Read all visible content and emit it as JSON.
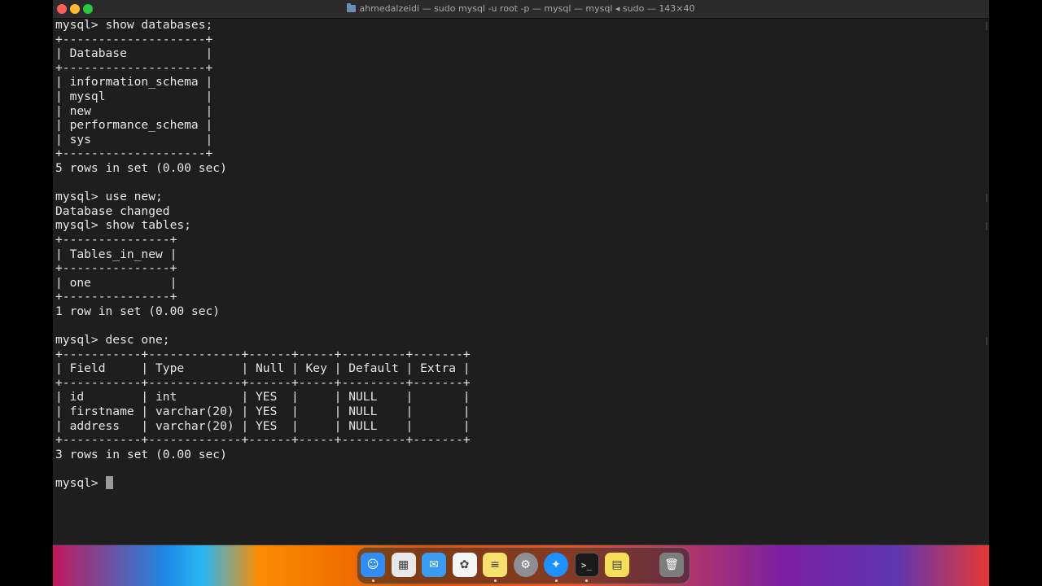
{
  "window": {
    "title": "ahmedalzeidi — sudo mysql -u root -p — mysql — mysql ◂ sudo — 143×40"
  },
  "terminal": {
    "lines": [
      "mysql> show databases;",
      "+--------------------+",
      "| Database           |",
      "+--------------------+",
      "| information_schema |",
      "| mysql              |",
      "| new                |",
      "| performance_schema |",
      "| sys                |",
      "+--------------------+",
      "5 rows in set (0.00 sec)",
      "",
      "mysql> use new;",
      "Database changed",
      "mysql> show tables;",
      "+---------------+",
      "| Tables_in_new |",
      "+---------------+",
      "| one           |",
      "+---------------+",
      "1 row in set (0.00 sec)",
      "",
      "mysql> desc one;",
      "+-----------+-------------+------+-----+---------+-------+",
      "| Field     | Type        | Null | Key | Default | Extra |",
      "+-----------+-------------+------+-----+---------+-------+",
      "| id        | int         | YES  |     | NULL    |       |",
      "| firstname | varchar(20) | YES  |     | NULL    |       |",
      "| address   | varchar(20) | YES  |     | NULL    |       |",
      "+-----------+-------------+------+-----+---------+-------+",
      "3 rows in set (0.00 sec)",
      ""
    ],
    "prompt": "mysql> "
  },
  "dock": {
    "apps": [
      {
        "name": "finder-icon",
        "glyph": "☺",
        "color": "#2f8df5",
        "running": true
      },
      {
        "name": "launchpad-icon",
        "glyph": "▦",
        "color": "#e8e8e8",
        "running": false
      },
      {
        "name": "mail-icon",
        "glyph": "✉",
        "color": "#3a9cf0",
        "running": false
      },
      {
        "name": "photos-icon",
        "glyph": "✿",
        "color": "#f5f5f5",
        "running": false
      },
      {
        "name": "notes-icon",
        "glyph": "≡",
        "color": "#f7e06b",
        "running": true
      },
      {
        "name": "system-settings-icon",
        "glyph": "⚙",
        "color": "#8e8e93",
        "running": false
      },
      {
        "name": "safari-icon",
        "glyph": "✦",
        "color": "#1e90ff",
        "running": true
      },
      {
        "name": "terminal-icon",
        "glyph": ">_",
        "color": "#1a1a1a",
        "running": true
      },
      {
        "name": "stickies-icon",
        "glyph": "▤",
        "color": "#f5df5a",
        "running": false
      },
      {
        "name": "trash-icon",
        "glyph": "🗑",
        "color": "#7d7d7d",
        "running": false
      }
    ]
  }
}
